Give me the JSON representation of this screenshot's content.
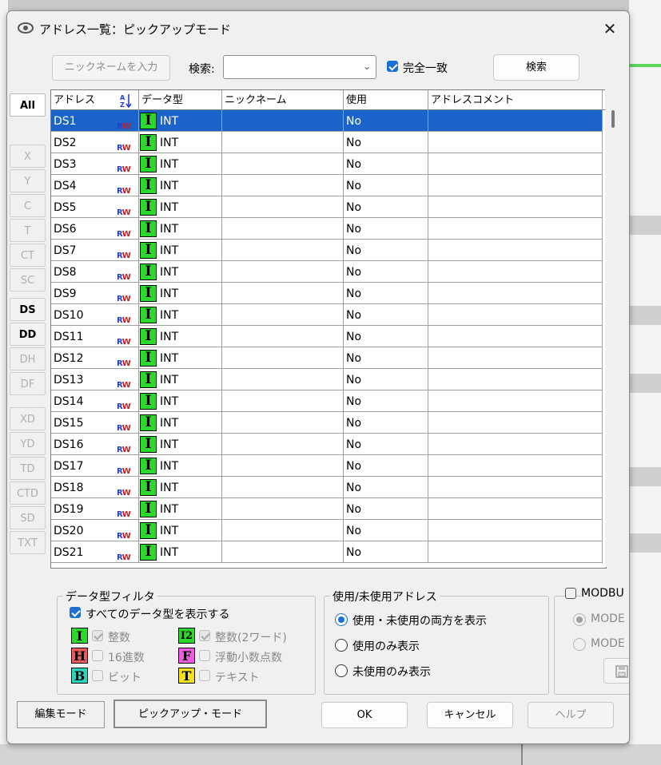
{
  "dialog": {
    "title": "アドレス一覧：ピックアップモード",
    "close_label": "✕"
  },
  "toolbar": {
    "nickname_button": "ニックネームを入力",
    "search_label": "検索:",
    "search_value": "",
    "exact_match_label": "完全一致",
    "exact_match_checked": true,
    "search_button": "検索"
  },
  "sidebar": [
    {
      "label": "All",
      "state": "selected"
    },
    {
      "label": "X",
      "state": "disabled"
    },
    {
      "label": "Y",
      "state": "disabled"
    },
    {
      "label": "C",
      "state": "disabled"
    },
    {
      "label": "T",
      "state": "disabled"
    },
    {
      "label": "CT",
      "state": "disabled"
    },
    {
      "label": "SC",
      "state": "disabled"
    },
    {
      "label": "DS",
      "state": "enabled"
    },
    {
      "label": "DD",
      "state": "enabled"
    },
    {
      "label": "DH",
      "state": "disabled"
    },
    {
      "label": "DF",
      "state": "disabled"
    },
    {
      "label": "XD",
      "state": "disabled"
    },
    {
      "label": "YD",
      "state": "disabled"
    },
    {
      "label": "TD",
      "state": "disabled"
    },
    {
      "label": "CTD",
      "state": "disabled"
    },
    {
      "label": "SD",
      "state": "disabled"
    },
    {
      "label": "TXT",
      "state": "disabled"
    }
  ],
  "table": {
    "headers": [
      "アドレス",
      "データ型",
      "ニックネーム",
      "使用",
      "アドレスコメント"
    ],
    "sort_icon": "az-sort-icon",
    "rw_read": "R",
    "rw_write": "W",
    "type_badge": "I",
    "rows": [
      {
        "address": "DS1",
        "type": "INT",
        "nickname": "",
        "used": "No",
        "comment": "",
        "selected": true
      },
      {
        "address": "DS2",
        "type": "INT",
        "nickname": "",
        "used": "No",
        "comment": ""
      },
      {
        "address": "DS3",
        "type": "INT",
        "nickname": "",
        "used": "No",
        "comment": ""
      },
      {
        "address": "DS4",
        "type": "INT",
        "nickname": "",
        "used": "No",
        "comment": ""
      },
      {
        "address": "DS5",
        "type": "INT",
        "nickname": "",
        "used": "No",
        "comment": ""
      },
      {
        "address": "DS6",
        "type": "INT",
        "nickname": "",
        "used": "No",
        "comment": ""
      },
      {
        "address": "DS7",
        "type": "INT",
        "nickname": "",
        "used": "No",
        "comment": ""
      },
      {
        "address": "DS8",
        "type": "INT",
        "nickname": "",
        "used": "No",
        "comment": ""
      },
      {
        "address": "DS9",
        "type": "INT",
        "nickname": "",
        "used": "No",
        "comment": ""
      },
      {
        "address": "DS10",
        "type": "INT",
        "nickname": "",
        "used": "No",
        "comment": ""
      },
      {
        "address": "DS11",
        "type": "INT",
        "nickname": "",
        "used": "No",
        "comment": ""
      },
      {
        "address": "DS12",
        "type": "INT",
        "nickname": "",
        "used": "No",
        "comment": ""
      },
      {
        "address": "DS13",
        "type": "INT",
        "nickname": "",
        "used": "No",
        "comment": ""
      },
      {
        "address": "DS14",
        "type": "INT",
        "nickname": "",
        "used": "No",
        "comment": ""
      },
      {
        "address": "DS15",
        "type": "INT",
        "nickname": "",
        "used": "No",
        "comment": ""
      },
      {
        "address": "DS16",
        "type": "INT",
        "nickname": "",
        "used": "No",
        "comment": ""
      },
      {
        "address": "DS17",
        "type": "INT",
        "nickname": "",
        "used": "No",
        "comment": ""
      },
      {
        "address": "DS18",
        "type": "INT",
        "nickname": "",
        "used": "No",
        "comment": ""
      },
      {
        "address": "DS19",
        "type": "INT",
        "nickname": "",
        "used": "No",
        "comment": ""
      },
      {
        "address": "DS20",
        "type": "INT",
        "nickname": "",
        "used": "No",
        "comment": ""
      },
      {
        "address": "DS21",
        "type": "INT",
        "nickname": "",
        "used": "No",
        "comment": ""
      }
    ]
  },
  "filter": {
    "title": "データ型フィルタ",
    "show_all_label": "すべてのデータ型を表示する",
    "show_all_checked": true,
    "types": [
      {
        "badge": "I",
        "label": "整数",
        "color": "#2bd82b"
      },
      {
        "badge": "I2",
        "label": "整数(2ワード)",
        "color": "#2bd82b"
      },
      {
        "badge": "H",
        "label": "16進数",
        "color": "#f05a5a"
      },
      {
        "badge": "F",
        "label": "浮動小数点数",
        "color": "#f05ae0"
      },
      {
        "badge": "B",
        "label": "ビット",
        "color": "#2ad6c0"
      },
      {
        "badge": "T",
        "label": "テキスト",
        "color": "#f2e21c"
      }
    ]
  },
  "usage": {
    "title": "使用/未使用アドレス",
    "options": [
      "使用・未使用の両方を表示",
      "使用のみ表示",
      "未使用のみ表示"
    ],
    "selected_index": 0
  },
  "modbus": {
    "title": "MODBU",
    "checked": false,
    "options": [
      "MODE",
      "MODE"
    ],
    "save_icon": "save-icon"
  },
  "footer": {
    "edit_mode": "編集モード",
    "pickup_mode": "ピックアップ・モード",
    "ok": "OK",
    "cancel": "キャンセル",
    "help": "ヘルプ"
  }
}
